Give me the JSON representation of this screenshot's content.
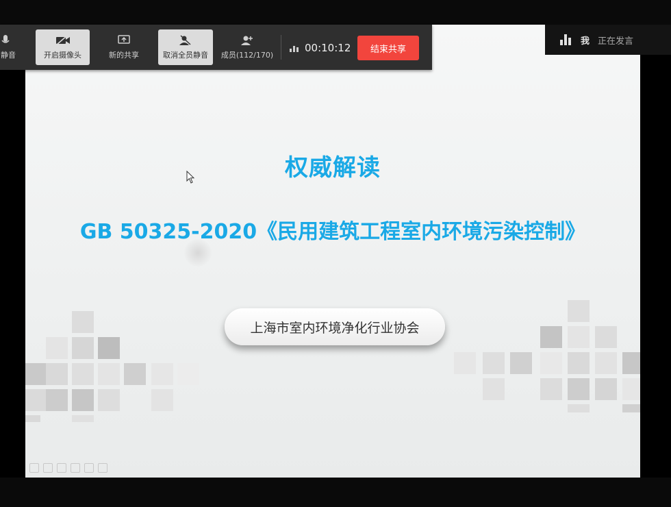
{
  "toolbar": {
    "mute_label": "静音",
    "camera_label": "开启摄像头",
    "new_share_label": "新的共享",
    "unmute_all_label": "取消全员静音",
    "members_label": "成员(112/170)",
    "timer": "00:10:12",
    "end_share_label": "结束共享"
  },
  "speaking": {
    "me": "我",
    "status": "正在发言"
  },
  "slide": {
    "title": "权威解读",
    "subtitle": "GB 50325-2020《民用建筑工程室内环境污染控制》",
    "organization": "上海市室内环境净化行业协会"
  },
  "colors": {
    "title_blue": "#1aa9e6",
    "end_share_red": "#f2453d",
    "toolbar_bg": "#2f2f2f"
  }
}
